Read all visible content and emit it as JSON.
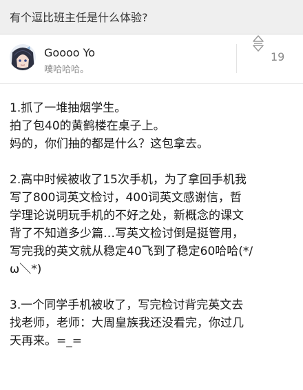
{
  "question": {
    "title": "有个逗比班主任是什么体验?"
  },
  "author": {
    "name": "Goooo Yo",
    "bio": "噗哈哈哈。",
    "avatar_icon": "anime-avatar-icon"
  },
  "votes": {
    "icon": "updown-vote-icon",
    "count": "19"
  },
  "answer": {
    "paragraphs": [
      "1.抓了一堆抽烟学生。\n拍了包40的黄鹤楼在桌子上。\n妈的，你们抽的都是什么？这包拿去。",
      "2.高中时候被收了15次手机，为了拿回手机我\n写了800词英文检讨，400词英文感谢信，哲\n学理论说明玩手机的不好之处，新概念的课文\n背了不知道多少篇…写英文检讨倒是挺管用，\n写完我的英文就从稳定40飞到了稳定60哈哈(*/\nω＼*)",
      "3.一个同学手机被收了，写完检讨背完英文去\n找老师，老师：大周皇族我还没看完，你过几\n天再来。=_="
    ]
  }
}
